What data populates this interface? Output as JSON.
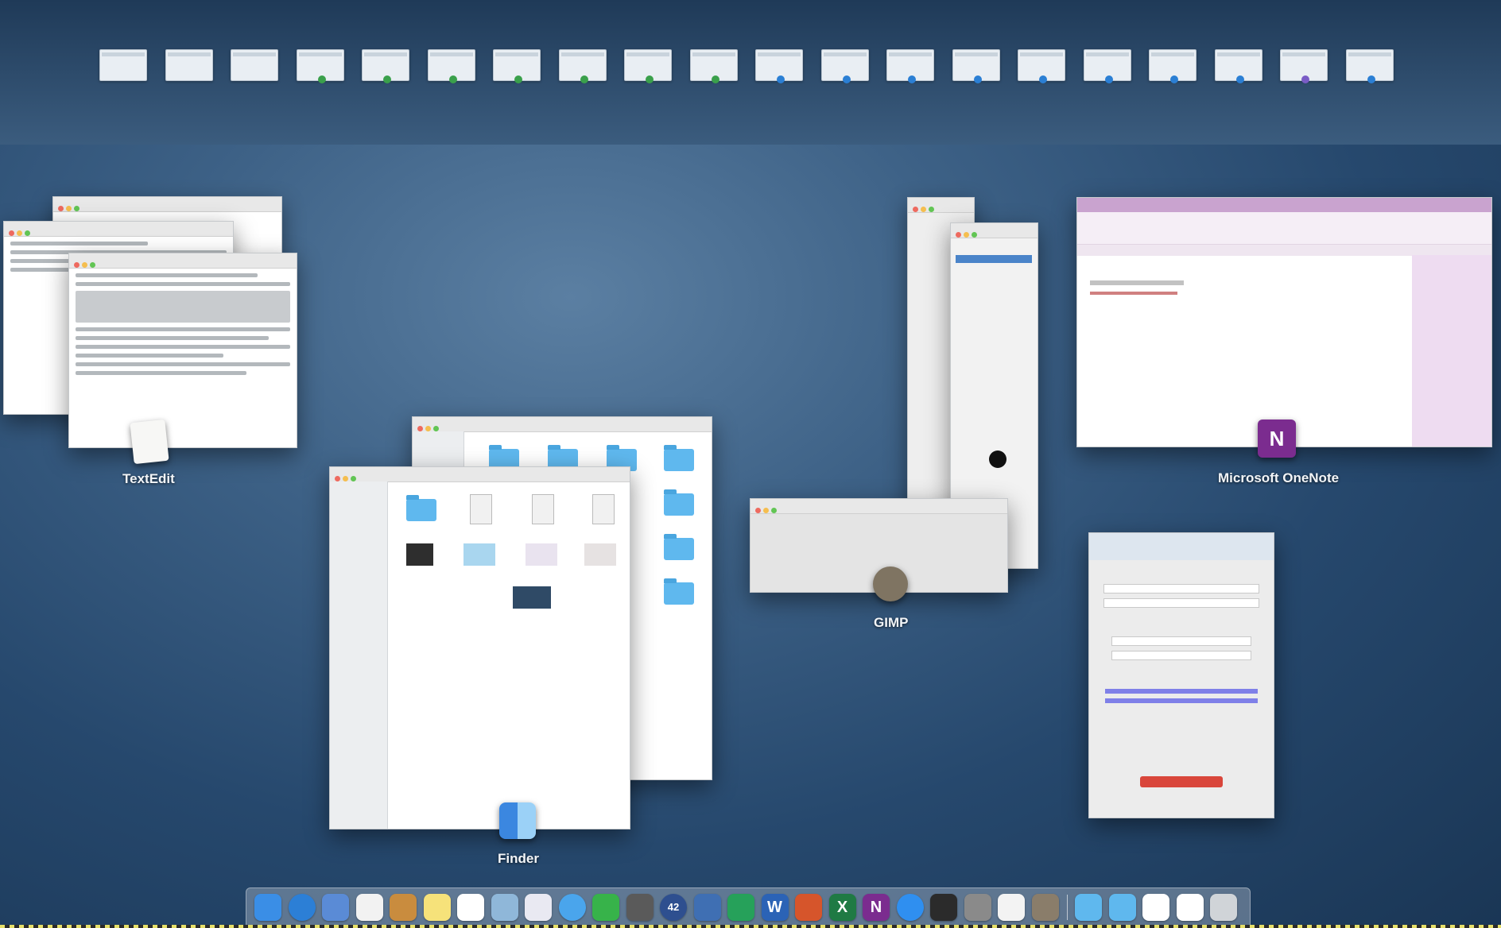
{
  "desktop": {
    "space_thumbnails": [
      {
        "name": "desktop-1",
        "mark": ""
      },
      {
        "name": "desktop-2",
        "mark": ""
      },
      {
        "name": "desktop-3",
        "mark": ""
      },
      {
        "name": "desktop-4",
        "mark": "#3aa04b"
      },
      {
        "name": "desktop-5",
        "mark": "#3aa04b"
      },
      {
        "name": "desktop-6",
        "mark": "#3aa04b"
      },
      {
        "name": "desktop-7",
        "mark": "#3aa04b"
      },
      {
        "name": "desktop-8",
        "mark": "#3aa04b"
      },
      {
        "name": "desktop-9",
        "mark": "#3aa04b"
      },
      {
        "name": "desktop-10",
        "mark": "#3aa04b"
      },
      {
        "name": "desktop-11",
        "mark": "#2b7fd4"
      },
      {
        "name": "desktop-12",
        "mark": "#2b7fd4"
      },
      {
        "name": "desktop-13",
        "mark": "#2b7fd4"
      },
      {
        "name": "desktop-14",
        "mark": "#2b7fd4"
      },
      {
        "name": "desktop-15",
        "mark": "#2b7fd4"
      },
      {
        "name": "desktop-16",
        "mark": "#2b7fd4"
      },
      {
        "name": "desktop-17",
        "mark": "#2b7fd4"
      },
      {
        "name": "desktop-18",
        "mark": "#2b7fd4"
      },
      {
        "name": "desktop-19",
        "mark": "#7a5cc6"
      },
      {
        "name": "desktop-20",
        "mark": "#2b7fd4"
      }
    ]
  },
  "apps": {
    "textedit": {
      "label": "TextEdit",
      "icon": "textedit-icon"
    },
    "finder": {
      "label": "Finder",
      "icon": "finder-icon"
    },
    "gimp": {
      "label": "GIMP",
      "icon": "gimp-icon"
    },
    "onenote": {
      "label": "Microsoft OneNote",
      "icon": "onenote-icon",
      "badge_letter": "N",
      "accent": "#7b2c8f"
    },
    "mail_account": {
      "label": "",
      "icon": "account-dialog",
      "primary_button_color": "#d9463b"
    }
  },
  "dock": {
    "items": [
      {
        "name": "finder",
        "color": "#3a8ee6"
      },
      {
        "name": "safari",
        "color": "#2c7fd6"
      },
      {
        "name": "mail",
        "color": "#5a8bd6"
      },
      {
        "name": "calendar",
        "color": "#f2f2f2"
      },
      {
        "name": "contacts",
        "color": "#c98c3e"
      },
      {
        "name": "notes",
        "color": "#f6e27a"
      },
      {
        "name": "reminders",
        "color": "#ffffff"
      },
      {
        "name": "preview",
        "color": "#8fb7d9"
      },
      {
        "name": "itunes",
        "color": "#e9e9f2"
      },
      {
        "name": "messages",
        "color": "#4aa5ec"
      },
      {
        "name": "facetime",
        "color": "#37b34a"
      },
      {
        "name": "activity",
        "color": "#5a5a5a"
      },
      {
        "name": "app-42",
        "color": "#2e4f8f"
      },
      {
        "name": "ibooks",
        "color": "#3f6fb3"
      },
      {
        "name": "numbers",
        "color": "#26a15a"
      },
      {
        "name": "word",
        "color": "#2b63b6"
      },
      {
        "name": "powerpoint",
        "color": "#d6552b"
      },
      {
        "name": "excel",
        "color": "#1f7a44"
      },
      {
        "name": "onenote",
        "color": "#7b2c8f"
      },
      {
        "name": "app-store",
        "color": "#2f8ff0"
      },
      {
        "name": "terminal",
        "color": "#2b2b2b"
      },
      {
        "name": "system-preferences",
        "color": "#8a8a8a"
      },
      {
        "name": "textedit",
        "color": "#f3f3f3"
      },
      {
        "name": "gimp",
        "color": "#8a7d6a"
      },
      {
        "name": "folder-applications",
        "color": "#5fb8ee"
      },
      {
        "name": "folder-documents",
        "color": "#5fb8ee"
      },
      {
        "name": "document-1",
        "color": "#ffffff"
      },
      {
        "name": "document-2",
        "color": "#ffffff"
      },
      {
        "name": "trash",
        "color": "#d0d4d8"
      }
    ],
    "badge_42": "42",
    "word_letter": "W",
    "excel_letter": "X",
    "onenote_letter": "N"
  }
}
